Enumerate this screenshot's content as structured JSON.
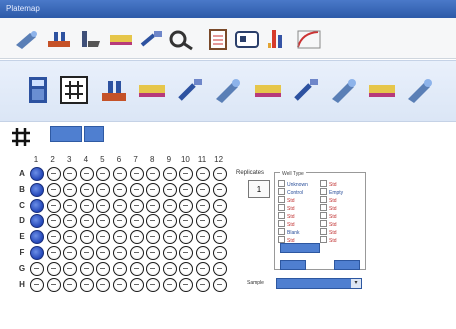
{
  "window": {
    "title": "Platemap"
  },
  "toolbar1": {
    "icons": [
      "pipette-icon",
      "multi-tip-icon",
      "dispense-icon",
      "plate-strip-icon",
      "transfer-icon",
      "microscope-icon",
      "clipboard-icon",
      "id-card-icon",
      "tip-rack-icon",
      "curve-icon"
    ]
  },
  "toolbar2": {
    "icons": [
      "document-icon",
      "grid-icon",
      "multi-tip-icon",
      "plate-strip-icon",
      "transfer-icon",
      "pipette-icon",
      "plate-strip-icon",
      "transfer-icon",
      "pipette-icon",
      "plate-strip-icon",
      "pipette-icon"
    ]
  },
  "plate": {
    "columns": [
      "1",
      "2",
      "3",
      "4",
      "5",
      "6",
      "7",
      "8",
      "9",
      "10",
      "11",
      "12"
    ],
    "rows": [
      "A",
      "B",
      "C",
      "D",
      "E",
      "F",
      "G",
      "H"
    ],
    "filled_rows": [
      "A",
      "B",
      "C",
      "D",
      "E",
      "F"
    ],
    "filled_column": "1"
  },
  "replicates": {
    "label": "Replicates",
    "value": "1"
  },
  "well_type": {
    "title": "Well Type",
    "options": [
      "Unknown",
      "Control",
      "Std",
      "Std",
      "Std",
      "Std",
      "Blank",
      "Std"
    ],
    "right_options": [
      "Std",
      "Empty",
      "Std",
      "Std",
      "Std",
      "Std",
      "Std",
      "Std"
    ]
  },
  "sample_select": {
    "label": "Sample"
  },
  "colors": {
    "accent": "#4f7fd0",
    "well_fill": "#2346b8",
    "titlebar": "#3a68ba"
  }
}
